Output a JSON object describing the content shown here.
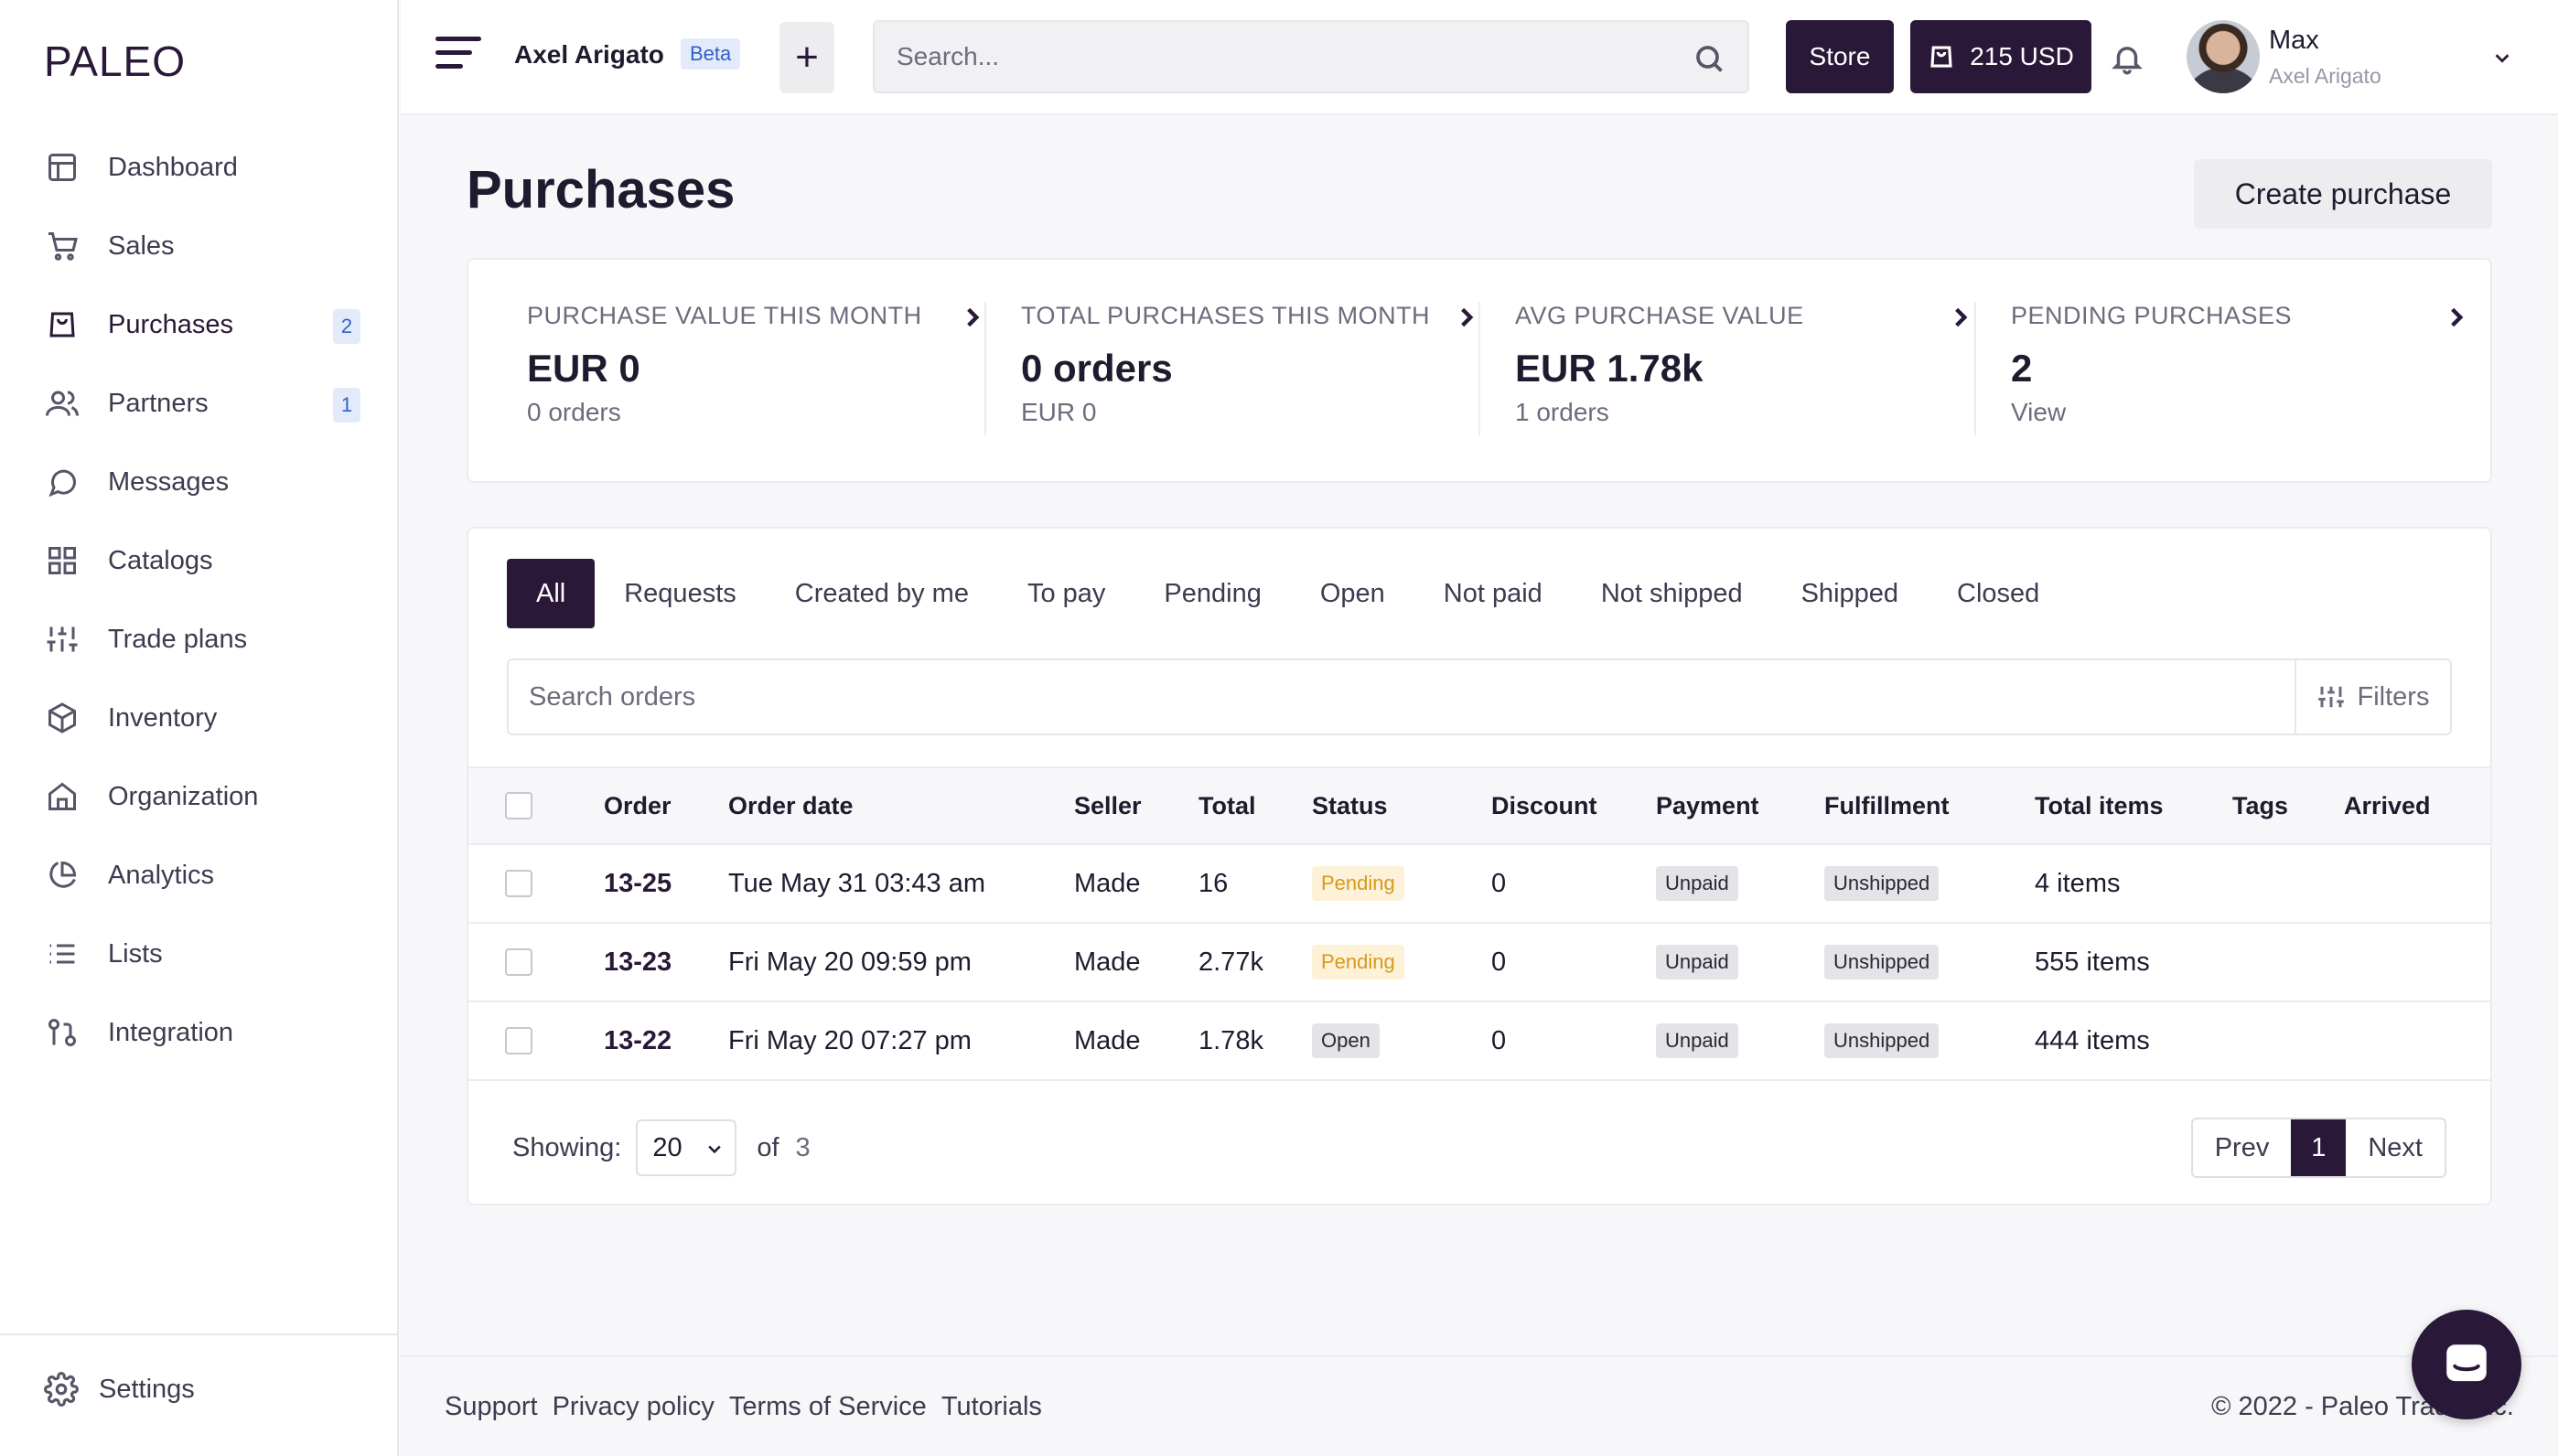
{
  "brand": {
    "logo": "PALEO"
  },
  "sidebar": {
    "items": [
      {
        "label": "Dashboard",
        "icon": "dashboard-icon",
        "badge": ""
      },
      {
        "label": "Sales",
        "icon": "cart-icon",
        "badge": ""
      },
      {
        "label": "Purchases",
        "icon": "bag-icon",
        "badge": "2"
      },
      {
        "label": "Partners",
        "icon": "users-icon",
        "badge": "1"
      },
      {
        "label": "Messages",
        "icon": "chat-icon",
        "badge": ""
      },
      {
        "label": "Catalogs",
        "icon": "grid-icon",
        "badge": ""
      },
      {
        "label": "Trade plans",
        "icon": "sliders-icon",
        "badge": ""
      },
      {
        "label": "Inventory",
        "icon": "box-icon",
        "badge": ""
      },
      {
        "label": "Organization",
        "icon": "home-icon",
        "badge": ""
      },
      {
        "label": "Analytics",
        "icon": "pie-icon",
        "badge": ""
      },
      {
        "label": "Lists",
        "icon": "list-icon",
        "badge": ""
      },
      {
        "label": "Integration",
        "icon": "git-icon",
        "badge": ""
      }
    ],
    "settings_label": "Settings"
  },
  "topbar": {
    "company": "Axel Arigato",
    "beta": "Beta",
    "add": "+",
    "search_placeholder": "Search...",
    "store_label": "Store",
    "wallet_label": "215 USD",
    "user_name": "Max",
    "user_org": "Axel Arigato"
  },
  "page": {
    "title": "Purchases",
    "create_label": "Create purchase"
  },
  "stats": [
    {
      "label": "PURCHASE VALUE THIS MONTH",
      "value": "EUR 0",
      "sub": "0 orders"
    },
    {
      "label": "TOTAL PURCHASES THIS MONTH",
      "value": "0 orders",
      "sub": "EUR 0"
    },
    {
      "label": "AVG PURCHASE VALUE",
      "value": "EUR 1.78k",
      "sub": "1 orders"
    },
    {
      "label": "PENDING PURCHASES",
      "value": "2",
      "sub": "View"
    }
  ],
  "tabs": [
    "All",
    "Requests",
    "Created by me",
    "To pay",
    "Pending",
    "Open",
    "Not paid",
    "Not shipped",
    "Shipped",
    "Closed"
  ],
  "orders_search_placeholder": "Search orders",
  "filters_label": "Filters",
  "table": {
    "headers": [
      "Order",
      "Order date",
      "Seller",
      "Total",
      "Status",
      "Discount",
      "Payment",
      "Fulfillment",
      "Total items",
      "Tags",
      "Arrived"
    ],
    "rows": [
      {
        "order": "13-25",
        "date": "Tue May 31 03:43 am",
        "seller": "Made",
        "total": "16",
        "status": "Pending",
        "discount": "0",
        "payment": "Unpaid",
        "fulfillment": "Unshipped",
        "items": "4 items"
      },
      {
        "order": "13-23",
        "date": "Fri May 20 09:59 pm",
        "seller": "Made",
        "total": "2.77k",
        "status": "Pending",
        "discount": "0",
        "payment": "Unpaid",
        "fulfillment": "Unshipped",
        "items": "555 items"
      },
      {
        "order": "13-22",
        "date": "Fri May 20 07:27 pm",
        "seller": "Made",
        "total": "1.78k",
        "status": "Open",
        "discount": "0",
        "payment": "Unpaid",
        "fulfillment": "Unshipped",
        "items": "444 items"
      }
    ]
  },
  "pagination": {
    "showing_label": "Showing:",
    "per_page": "20",
    "of_label": "of",
    "total": "3",
    "prev": "Prev",
    "current": "1",
    "next": "Next"
  },
  "footer": {
    "links": [
      "Support",
      "Privacy policy",
      "Terms of Service",
      "Tutorials"
    ],
    "copyright": "© 2022 - Paleo Trade Inc."
  },
  "colors": {
    "primary": "#2a1838",
    "pending": "#d69a1d",
    "badge": "#2f5fc9"
  }
}
